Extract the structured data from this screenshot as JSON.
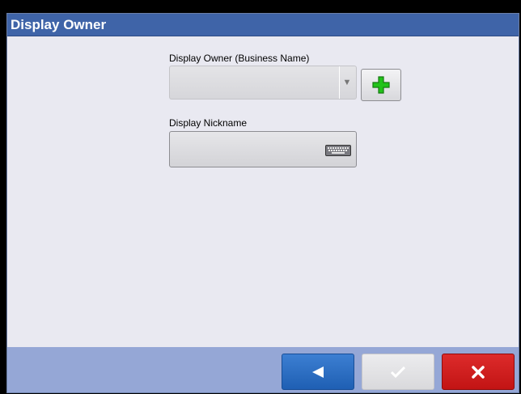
{
  "window": {
    "title": "Display Owner"
  },
  "owner": {
    "label": "Display Owner (Business Name)",
    "value": "",
    "dropdown_icon": "triangle-down-icon",
    "add_icon": "green-plus-icon"
  },
  "nickname": {
    "label": "Display Nickname",
    "value": "",
    "keyboard_icon": "keyboard-icon"
  },
  "footer": {
    "back_icon": "left-arrow-icon",
    "ok_icon": "checkmark-icon",
    "cancel_icon": "x-icon"
  },
  "colors": {
    "title_bar": "#3f64a8",
    "background": "#e9e9f1",
    "footer": "#95a7d6",
    "back_button": "#2a6cc4",
    "cancel_button": "#d11e1e",
    "add_plus": "#22c31a"
  }
}
